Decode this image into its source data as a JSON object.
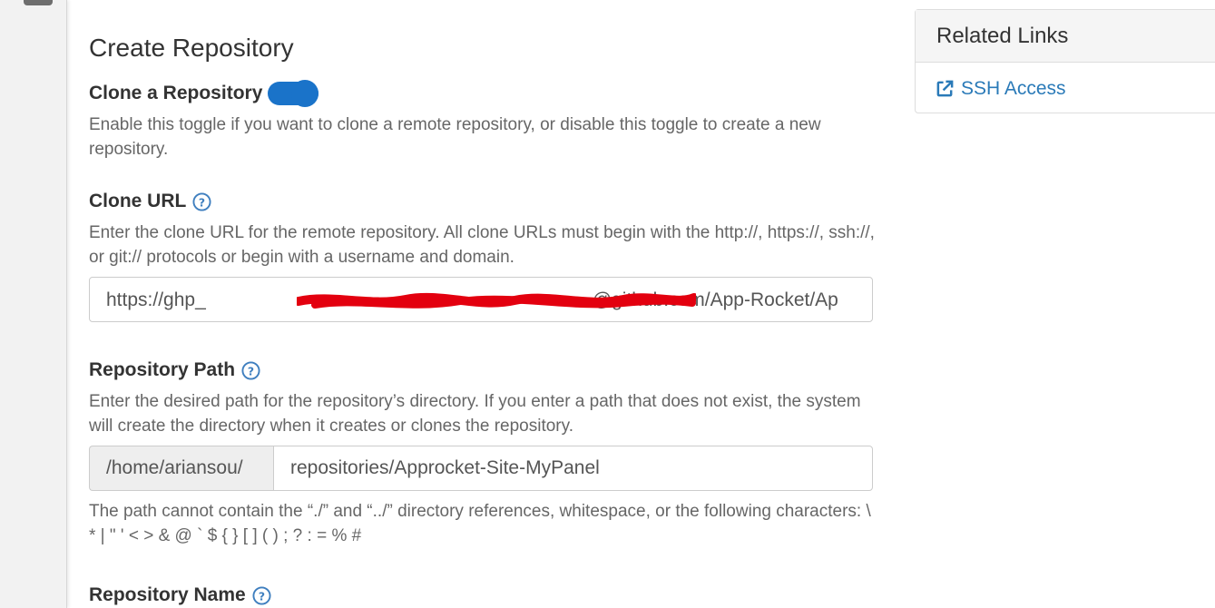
{
  "page": {
    "title": "Create Repository"
  },
  "clone_toggle": {
    "label": "Clone a Repository",
    "enabled": true,
    "help": "Enable this toggle if you want to clone a remote repository, or disable this toggle to create a new repository."
  },
  "clone_url": {
    "label": "Clone URL",
    "help": "Enter the clone URL for the remote repository. All clone URLs must begin with the http://, https://, ssh://, or git:// protocols or begin with a username and domain.",
    "value_prefix": "https://ghp_",
    "value_suffix": "@github.com/App-Rocket/Ap"
  },
  "repo_path": {
    "label": "Repository Path",
    "help": "Enter the desired path for the repository’s directory. If you enter a path that does not exist, the system will create the directory when it creates or clones the repository.",
    "prefix": "/home/ariansou/",
    "value": "repositories/Approcket-Site-MyPanel",
    "note": "The path cannot contain the “./” and “../” directory references, whitespace, or the following characters: \\ * | \" ' < > & @ ` $ { } [ ] ( ) ; ? : = % #"
  },
  "repo_name": {
    "label": "Repository Name"
  },
  "related_links": {
    "heading": "Related Links",
    "links": [
      {
        "label": "SSH Access",
        "icon": "external-link-icon"
      }
    ]
  },
  "colors": {
    "accent": "#1a73c9",
    "link": "#2a7ab8",
    "help_icon": "#3f7fbf",
    "redaction": "#e3000f"
  }
}
